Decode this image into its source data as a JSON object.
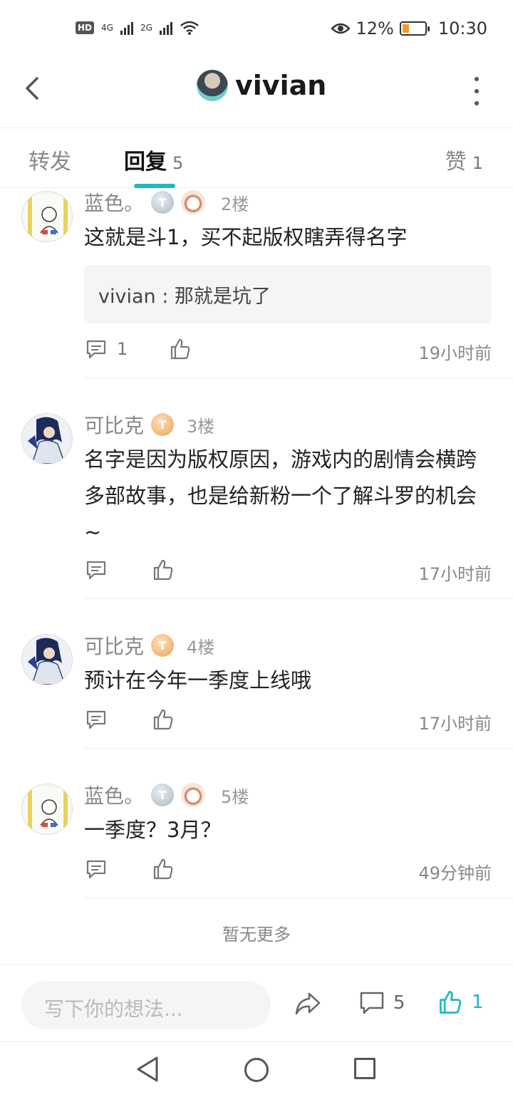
{
  "status": {
    "hd": "HD",
    "net1": "4G",
    "net2": "2G",
    "battery_pct_text": "12%",
    "battery_level": 0.12,
    "time": "10:30"
  },
  "header": {
    "title": "vivian"
  },
  "tabs": [
    {
      "label": "转发",
      "count": ""
    },
    {
      "label": "回复",
      "count": "5"
    },
    {
      "label": "赞",
      "count": "1"
    }
  ],
  "comments": [
    {
      "name": "蓝色。",
      "badge": "T",
      "floor": "2楼",
      "text": "这就是斗1，买不起版权瞎弄得名字",
      "quote": "vivian : 那就是坑了",
      "reply_count": "1",
      "time": "19小时前"
    },
    {
      "name": "可比克",
      "badge": "T",
      "floor": "3楼",
      "text": "名字是因为版权原因，游戏内的剧情会横跨多部故事，也是给新粉一个了解斗罗的机会~",
      "reply_count": "",
      "time": "17小时前"
    },
    {
      "name": "可比克",
      "badge": "T",
      "floor": "4楼",
      "text": "预计在今年一季度上线哦",
      "reply_count": "",
      "time": "17小时前"
    },
    {
      "name": "蓝色。",
      "badge": "T",
      "floor": "5楼",
      "text": "一季度？3月？",
      "reply_count": "",
      "time": "49分钟前"
    }
  ],
  "no_more": "暂无更多",
  "bottom": {
    "placeholder": "写下你的想法...",
    "comment_count": "5",
    "like_count": "1"
  },
  "icons": {
    "accent_color": "#1fb9c6"
  }
}
